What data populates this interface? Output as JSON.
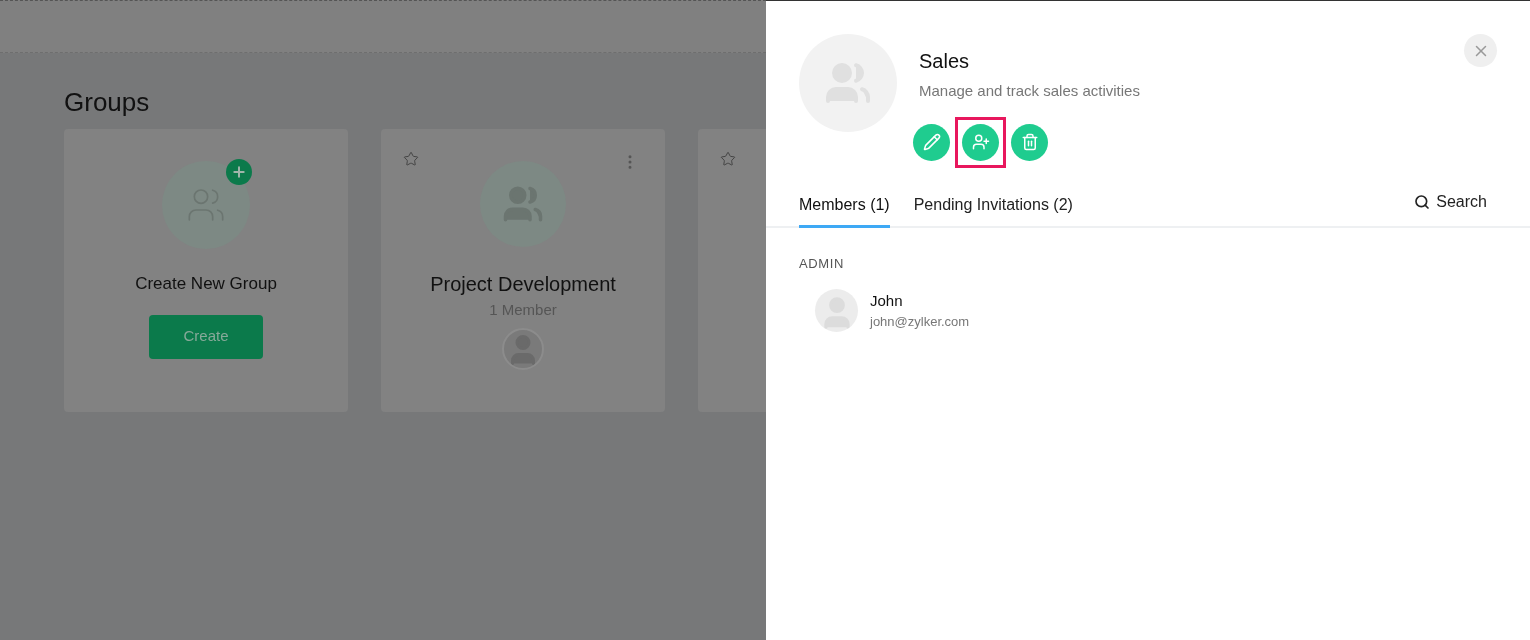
{
  "page": {
    "title": "Groups"
  },
  "cards": [
    {
      "kind": "create",
      "name": "Create New Group",
      "button": "Create"
    },
    {
      "kind": "group",
      "name": "Project Development",
      "members": "1 Member",
      "starred": false
    },
    {
      "kind": "partial",
      "starred": false
    }
  ],
  "panel": {
    "name": "Sales",
    "description": "Manage and track sales activities",
    "actions": [
      {
        "kind": "edit",
        "highlighted": false
      },
      {
        "kind": "add-member",
        "highlighted": true
      },
      {
        "kind": "delete",
        "highlighted": false
      }
    ],
    "tabs": [
      {
        "label": "Members (1)",
        "selected": true
      },
      {
        "label": "Pending Invitations (2)",
        "selected": false
      }
    ],
    "search": "Search",
    "section": "ADMIN",
    "members": [
      {
        "name": "John",
        "email": "john@zylker.com"
      }
    ]
  }
}
